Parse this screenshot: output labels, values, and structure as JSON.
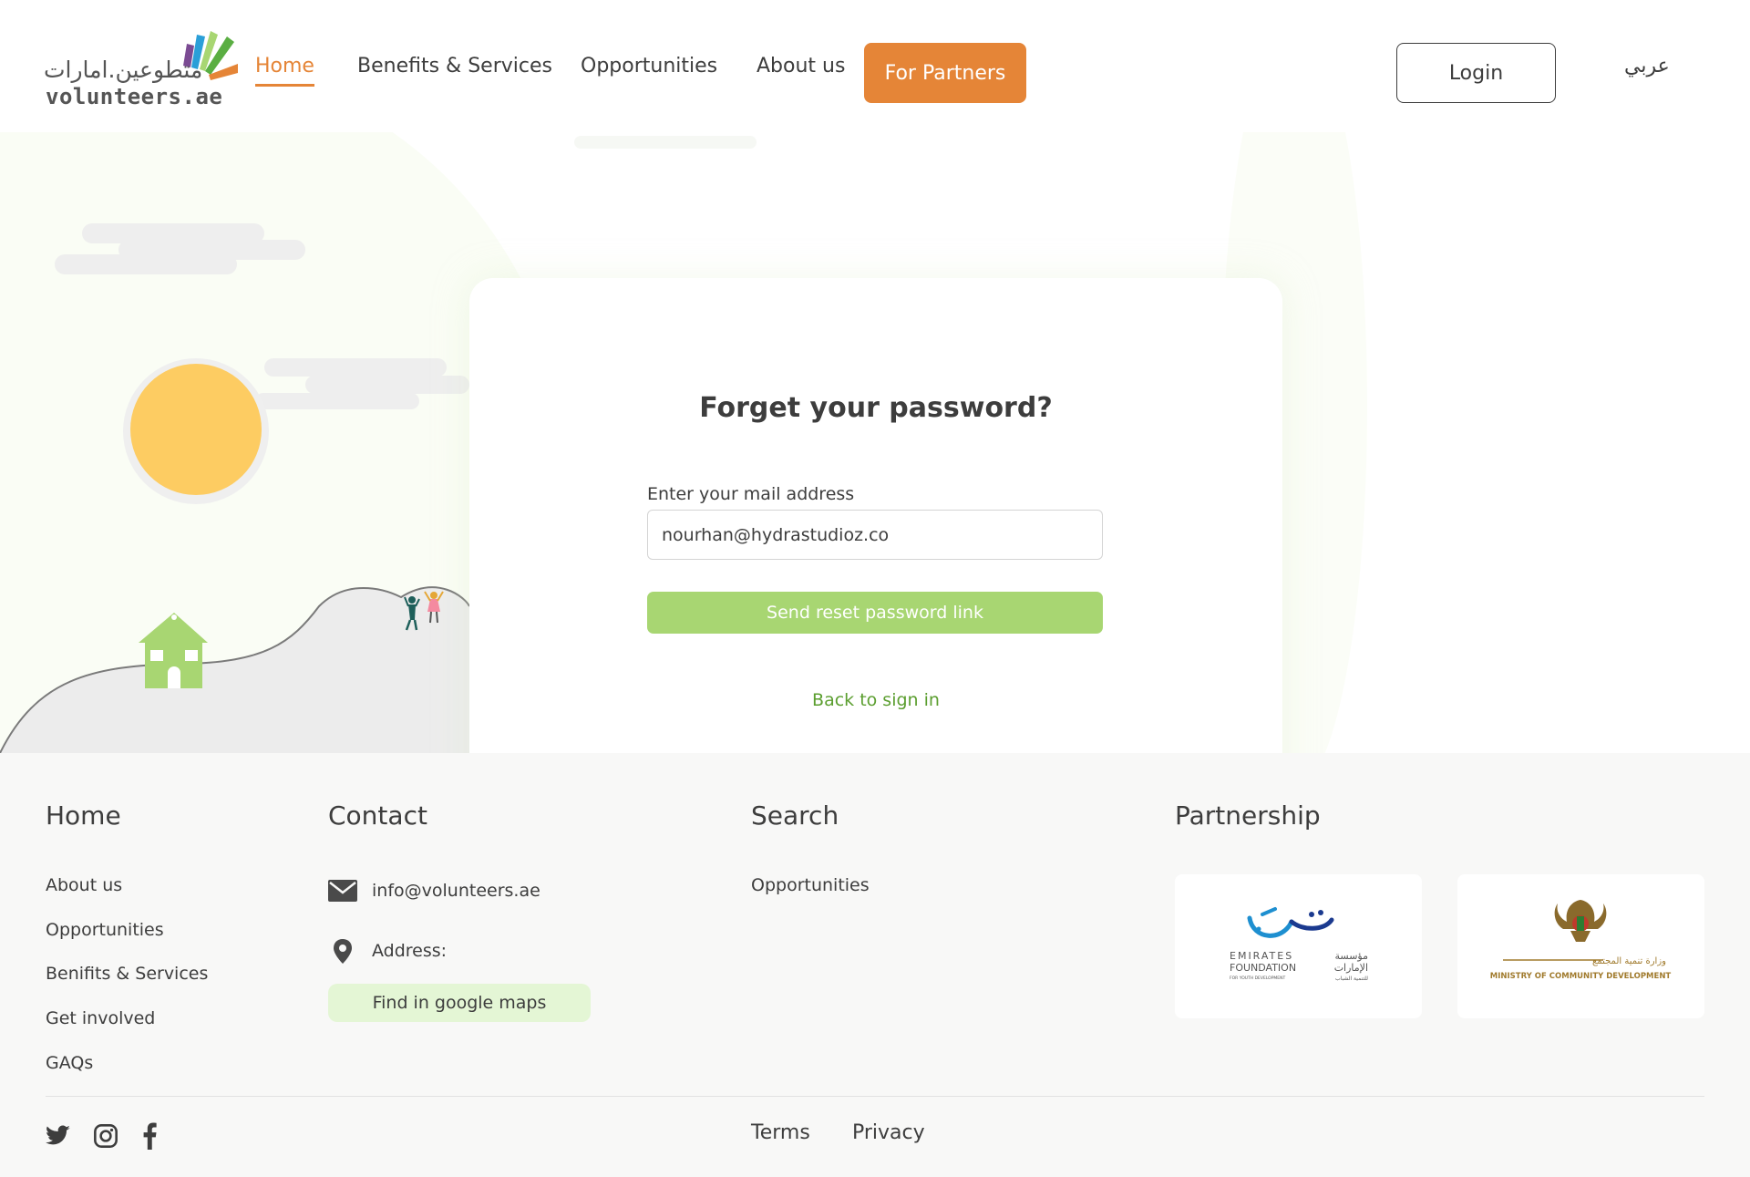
{
  "header": {
    "logo_arabic": "متطوعين.امارات",
    "logo_english": "volunteers.ae",
    "nav": {
      "home": "Home",
      "benefits": "Benefits & Services",
      "opportunities": "Opportunities",
      "about": "About us"
    },
    "partners_button": "For Partners",
    "login_button": "Login",
    "language": "عربي"
  },
  "form": {
    "title": "Forget your password?",
    "email_label": "Enter your mail address",
    "email_value": "nourhan@hydrastudioz.co",
    "submit_button": "Send reset password link",
    "back_link": "Back to sign in"
  },
  "footer": {
    "home": {
      "title": "Home",
      "links": [
        "About us",
        "Opportunities",
        "Benifits & Services",
        "Get involved",
        "GAQs"
      ]
    },
    "contact": {
      "title": "Contact",
      "email": "info@volunteers.ae",
      "address_label": "Address:",
      "maps_button": "Find in google maps"
    },
    "search": {
      "title": "Search",
      "links": [
        "Opportunities"
      ]
    },
    "partnership": {
      "title": "Partnership",
      "partners": [
        {
          "name_en_1": "EMIRATES",
          "name_en_2": "FOUNDATION",
          "tagline": "FOR YOUTH DEVELOPMENT",
          "name_ar_1": "مؤسسة",
          "name_ar_2": "الإمارات",
          "name_ar_3": "للتنمية الشباب"
        },
        {
          "name_ar": "وزارة تنمية المجتمع",
          "name_en": "MINISTRY OF COMMUNITY DEVELOPMENT"
        }
      ]
    },
    "bottom": {
      "terms": "Terms",
      "privacy": "Privacy"
    },
    "social_icons": [
      "twitter-icon",
      "instagram-icon",
      "facebook-icon"
    ]
  },
  "colors": {
    "accent_orange": "#e58537",
    "primary_green": "#a8d672",
    "link_green": "#5b9e2f",
    "sun_yellow": "#fdcc62",
    "footer_bg": "#f8f8f7"
  }
}
